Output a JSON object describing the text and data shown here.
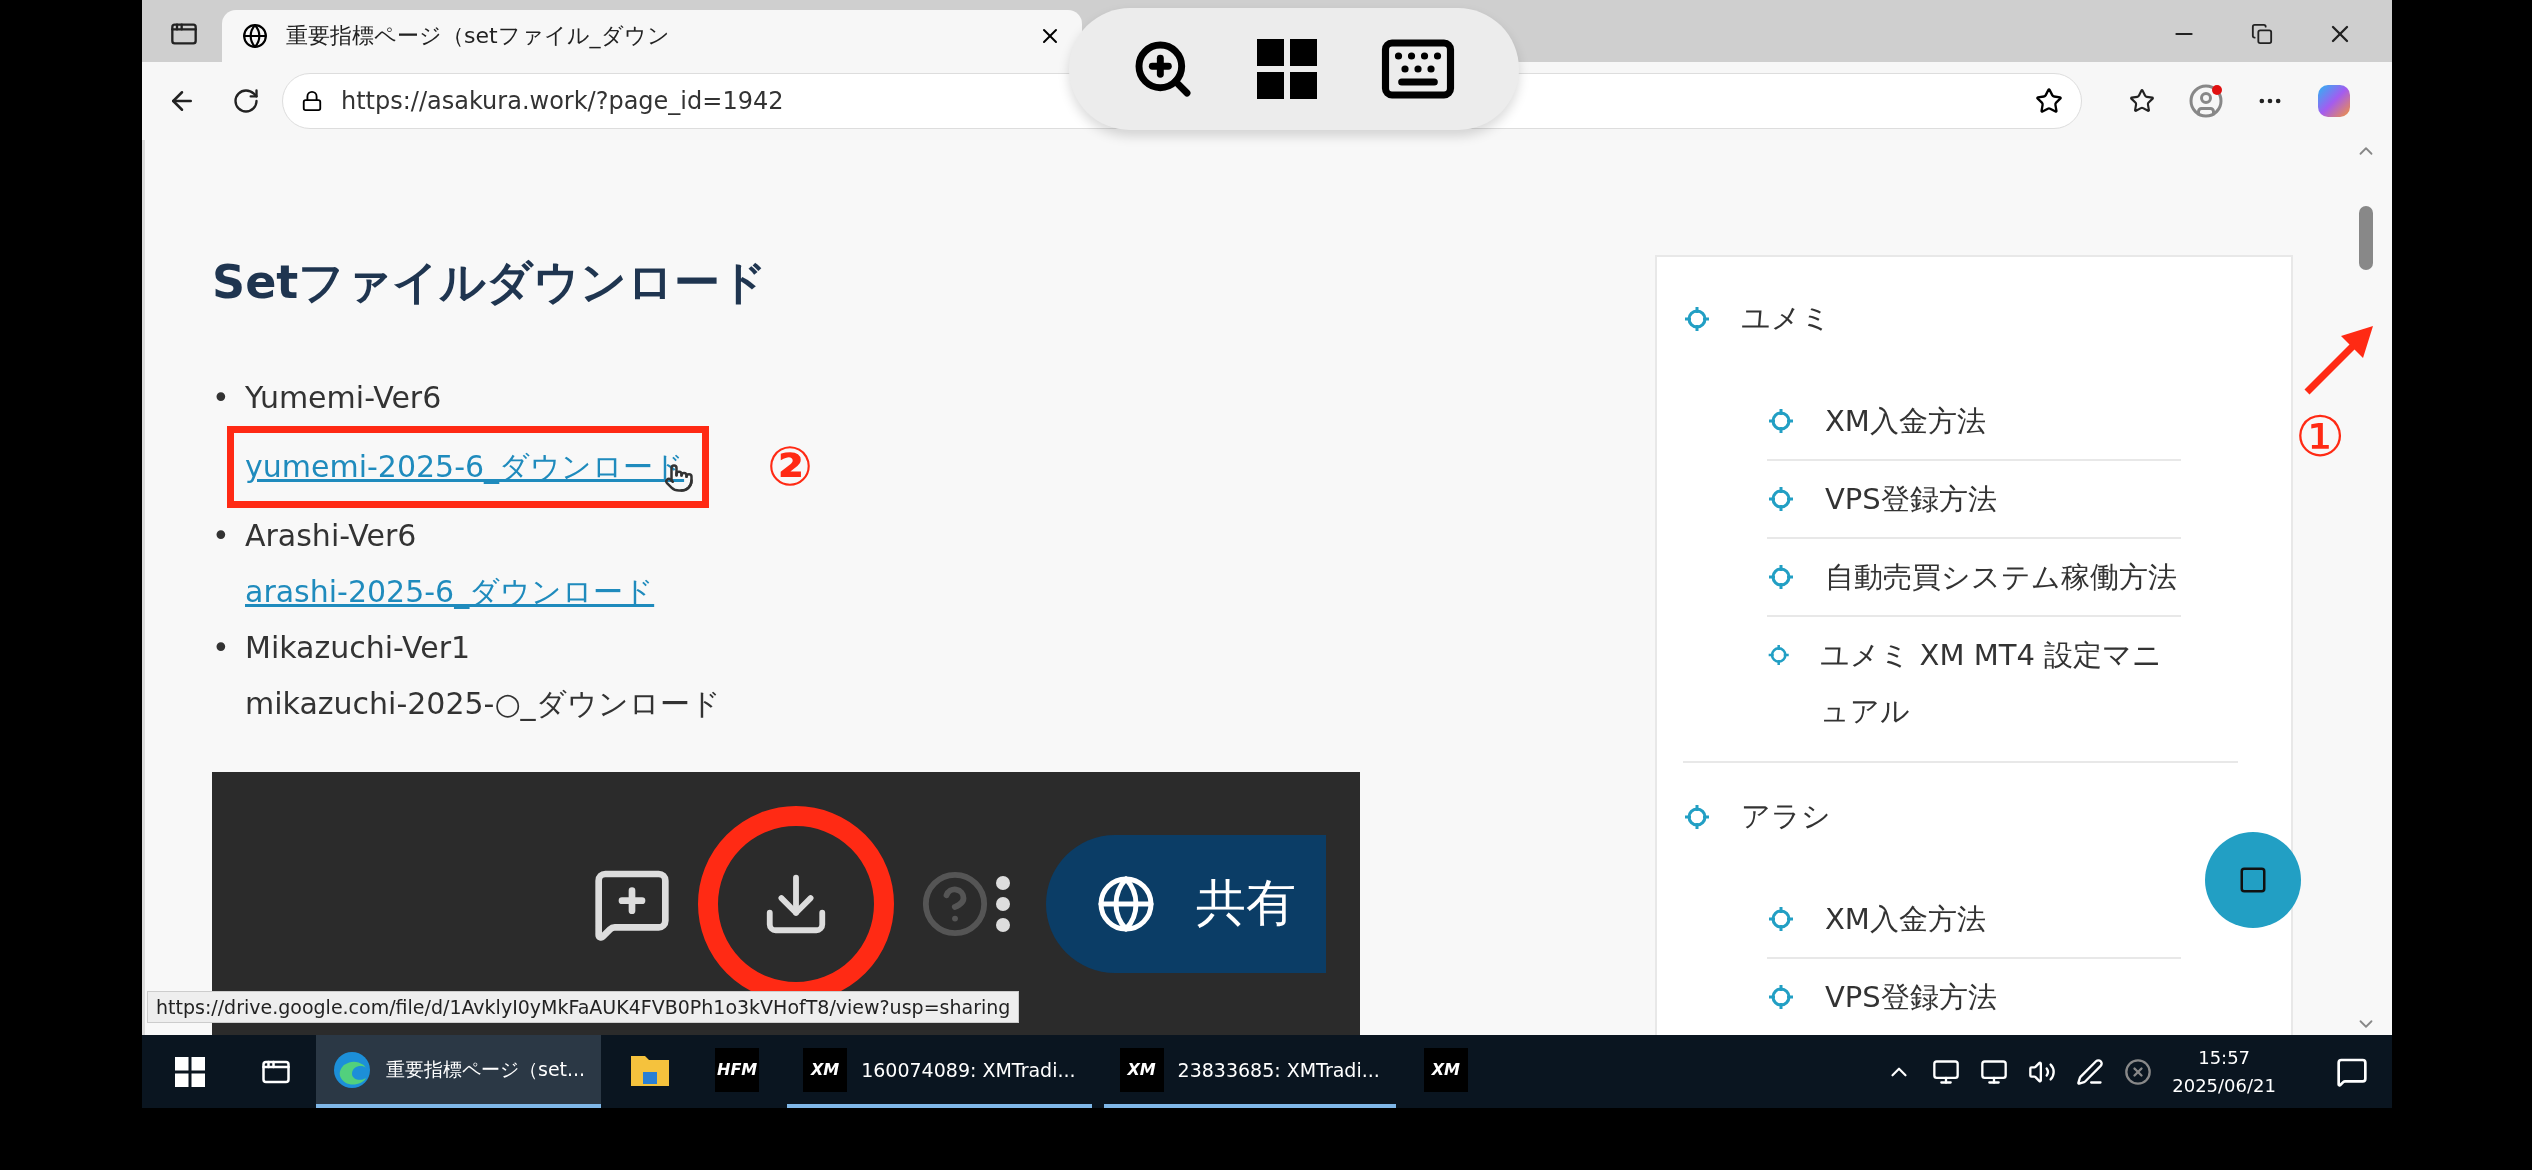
{
  "browser": {
    "tab": {
      "title": "重要指標ページ（setファイル_ダウン",
      "selected": true
    },
    "address": "https://asakura.work/?page_id=1942"
  },
  "page": {
    "heading": "Setファイルダウンロード",
    "downloads": [
      {
        "marker": "•",
        "name": "Yumemi-Ver6",
        "file": "yumemi-2025-6_ダウンロード",
        "linked": true,
        "annotation": "②"
      },
      {
        "marker": "•",
        "name": "Arashi-Ver6",
        "file": "arashi-2025-6_ダウンロード",
        "linked": true
      },
      {
        "marker": "•",
        "name": "Mikazuchi-Ver1",
        "file": "mikazuchi-2025-○_ダウンロード",
        "linked": false
      }
    ],
    "drive_capture": {
      "share_label": "共有",
      "download_circled": true
    },
    "status_url": "https://drive.google.com/file/d/1AvklyI0yMkFaAUK4FVB0Ph1o3kVHofT8/view?usp=sharing"
  },
  "sidebar": {
    "sections": [
      {
        "title": "ユメミ",
        "children": [
          {
            "title": "XM入金方法"
          },
          {
            "title": "VPS登録方法"
          },
          {
            "title": "自動売買システム稼働方法"
          },
          {
            "title": "ユメミ XM MT4 設定マニュアル"
          }
        ]
      },
      {
        "title": "アラシ",
        "children": [
          {
            "title": "XM入金方法"
          },
          {
            "title": "VPS登録方法"
          }
        ]
      }
    ]
  },
  "scrollbar_annotation": "①",
  "taskbar": {
    "apps": [
      {
        "kind": "edge",
        "label": "重要指標ページ（set...",
        "selected": true,
        "open": true
      },
      {
        "kind": "folder",
        "selected": false,
        "open": false
      },
      {
        "kind": "logo",
        "logo": "HFM",
        "selected": false,
        "open": false
      },
      {
        "kind": "logo",
        "logo": "XM",
        "label": "160074089: XMTradi...",
        "selected": false,
        "open": true
      },
      {
        "kind": "logo",
        "logo": "XM",
        "label": "23833685: XMTradi...",
        "selected": false,
        "open": true
      },
      {
        "kind": "logo",
        "logo": "XM",
        "selected": false,
        "open": false
      }
    ],
    "time": "15:57",
    "date": "2025/06/21"
  }
}
